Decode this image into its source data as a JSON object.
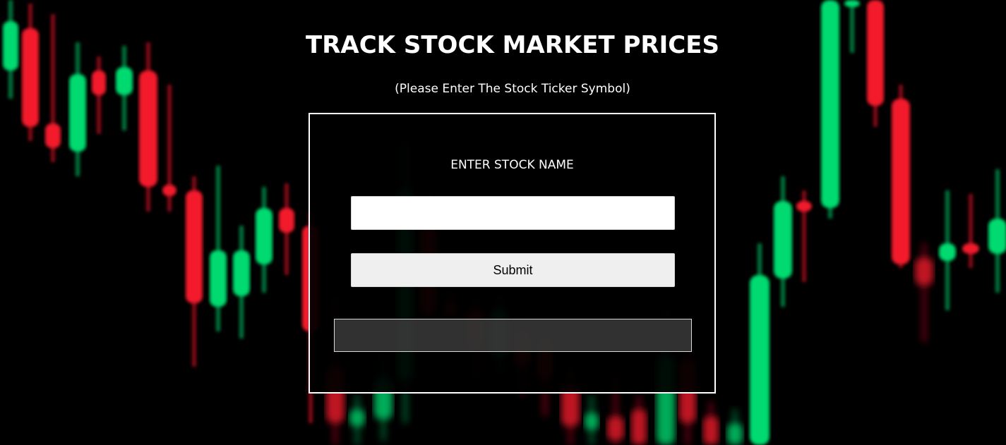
{
  "header": {
    "title": "TRACK STOCK MARKET PRICES",
    "subtitle": "(Please Enter The Stock Ticker Symbol)"
  },
  "form": {
    "label": "ENTER STOCK NAME",
    "input_value": "",
    "input_placeholder": "",
    "submit_label": "Submit",
    "result_text": ""
  },
  "background": {
    "description_icon": "candlestick-chart-background",
    "colors": {
      "up": "#00e676",
      "down": "#ff1a2e",
      "base": "#000000"
    }
  }
}
